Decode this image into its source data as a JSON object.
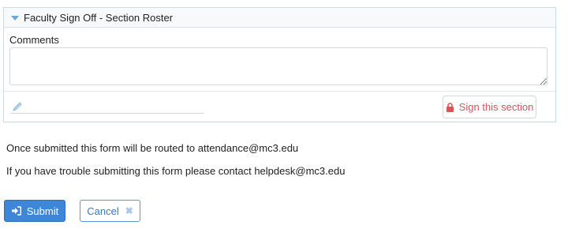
{
  "panel": {
    "title": "Faculty Sign Off - Section Roster",
    "comments_label": "Comments",
    "comments_value": "",
    "signature_value": "",
    "sign_button": "Sign this section"
  },
  "info": {
    "routing": "Once submitted this form will be routed to attendance@mc3.edu",
    "help": "If you have trouble submitting this form please contact helpdesk@mc3.edu"
  },
  "actions": {
    "submit": "Submit",
    "cancel": "Cancel"
  },
  "icons": {
    "collapse": "caret-down-icon",
    "signature": "pencil-icon",
    "sign": "lock-icon",
    "submit": "sign-in-icon",
    "cancel": "close-icon"
  },
  "colors": {
    "accent": "#3d86d8",
    "sign_text": "#e0525a",
    "panel_border": "#c9dcea"
  }
}
